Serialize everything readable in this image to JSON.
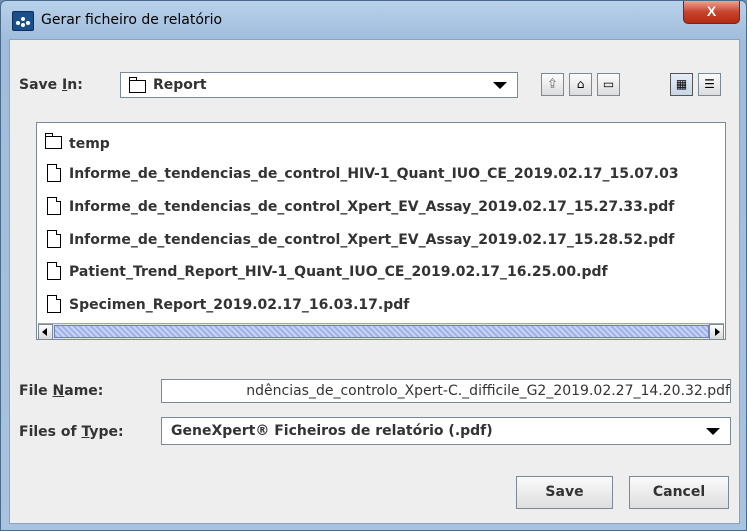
{
  "window": {
    "title": "Gerar ficheiro de relatório",
    "close_label": "X"
  },
  "save_in": {
    "label_prefix": "Save ",
    "label_underlined": "I",
    "label_suffix": "n:",
    "value": "Report",
    "icon": "folder-icon"
  },
  "toolbar": {
    "buttons": [
      {
        "name": "up-one-level",
        "icon": "folder-up-icon",
        "glyph": "⮸"
      },
      {
        "name": "home",
        "icon": "home-icon",
        "glyph": "⌂"
      },
      {
        "name": "new-folder",
        "icon": "new-folder-icon",
        "glyph": "▭"
      },
      {
        "name": "list-view",
        "icon": "list-view-icon",
        "glyph": "▦"
      },
      {
        "name": "details-view",
        "icon": "details-view-icon",
        "glyph": "☰"
      }
    ]
  },
  "files": [
    {
      "name": "temp",
      "type": "folder"
    },
    {
      "name": "Informe_de_tendencias_de_control_HIV-1_Quant_IUO_CE_2019.02.17_15.07.03",
      "type": "file"
    },
    {
      "name": "Informe_de_tendencias_de_control_Xpert_EV_Assay_2019.02.17_15.27.33.pdf",
      "type": "file"
    },
    {
      "name": "Informe_de_tendencias_de_control_Xpert_EV_Assay_2019.02.17_15.28.52.pdf",
      "type": "file"
    },
    {
      "name": "Patient_Trend_Report_HIV-1_Quant_IUO_CE_2019.02.17_16.25.00.pdf",
      "type": "file"
    },
    {
      "name": "Specimen_Report_2019.02.17_16.03.17.pdf",
      "type": "file"
    }
  ],
  "file_name": {
    "label_prefix": "File ",
    "label_underlined": "N",
    "label_suffix": "ame:",
    "value": "ndências_de_controlo_Xpert-C._difficile_G2_2019.02.27_14.20.32.pdf"
  },
  "file_type": {
    "label_prefix": "Files of ",
    "label_underlined": "T",
    "label_suffix": "ype:",
    "value": "GeneXpert® Ficheiros de relatório (.pdf)"
  },
  "buttons": {
    "save": "Save",
    "cancel": "Cancel"
  },
  "colors": {
    "titlebar": "#b9d1ea",
    "close_button": "#c8442c",
    "dialog_bg": "#eeeeee",
    "scroll_thumb": "#b8c8f0"
  }
}
